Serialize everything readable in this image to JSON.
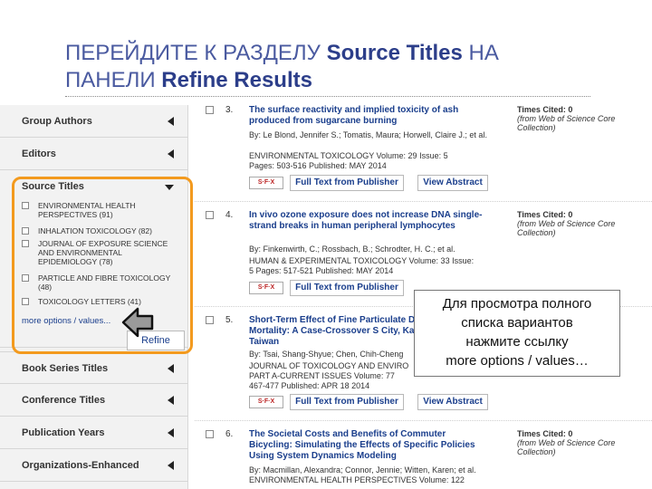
{
  "slide": {
    "title_line1_a": "ПЕРЕЙДИТЕ К РАЗДЕЛУ ",
    "title_line1_b": "Source Titles",
    "title_line1_c": "  НА",
    "title_line2_a": "ПАНЕЛИ ",
    "title_line2_b": "Refine Results"
  },
  "sidebar": {
    "group_authors": "Group Authors",
    "editors": "Editors",
    "source_titles": "Source Titles",
    "source_items": [
      "ENVIRONMENTAL HEALTH PERSPECTIVES (91)",
      "INHALATION TOXICOLOGY (82)",
      "JOURNAL OF EXPOSURE SCIENCE AND ENVIRONMENTAL EPIDEMIOLOGY (78)",
      "PARTICLE AND FIBRE TOXICOLOGY (48)",
      "TOXICOLOGY LETTERS (41)"
    ],
    "more_options": "more options / values...",
    "refine": "Refine",
    "book_series": "Book Series Titles",
    "conference": "Conference Titles",
    "publication_years": "Publication Years",
    "organizations": "Organizations-Enhanced"
  },
  "results": [
    {
      "num": "3.",
      "title": "The surface reactivity and implied toxicity of ash produced from sugarcane burning",
      "authors": "By: Le Blond, Jennifer S.; Tomatis, Maura; Horwell, Claire J.; et al.",
      "journal": "ENVIRONMENTAL TOXICOLOGY  Volume: 29  Issue: 5",
      "pages": "Pages: 503-516  Published: MAY 2014",
      "times_cited": "Times Cited: 0",
      "wos": "(from Web of Science Core Collection)"
    },
    {
      "num": "4.",
      "title": "In vivo ozone exposure does not increase DNA single-strand breaks in human peripheral lymphocytes",
      "authors": "By: Finkenwirth, C.; Rossbach, B.; Schrodter, H. C.; et al.",
      "journal": "HUMAN & EXPERIMENTAL TOXICOLOGY  Volume: 33  Issue:",
      "pages": "5  Pages: 517-521  Published: MAY 2014",
      "times_cited": "Times Cited: 0",
      "wos": "(from Web of Science Core Collection)"
    },
    {
      "num": "5.",
      "title": "Short-Term Effect of Fine Particulate Daily Mortality: A Case-Crossover S City, Kaohsiung, Taiwan",
      "authors": "By: Tsai, Shang-Shyue; Chen, Chih-Cheng",
      "journal": "JOURNAL OF TOXICOLOGY AND ENVIRO",
      "pages": "PART A-CURRENT ISSUES  Volume: 77",
      "pages2": "467-477  Published: APR 18 2014"
    },
    {
      "num": "6.",
      "title": "The Societal Costs and Benefits of Commuter Bicycling: Simulating the Effects of Specific Policies Using System Dynamics Modeling",
      "authors": "By: Macmillan, Alexandra; Connor, Jennie; Witten, Karen; et al.",
      "journal": "ENVIRONMENTAL HEALTH PERSPECTIVES  Volume: 122",
      "times_cited": "Times Cited: 0",
      "wos": "(from Web of Science Core Collection)"
    }
  ],
  "buttons": {
    "sfx": "S·F·X",
    "full_text": "Full Text from Publisher",
    "view_abstract": "View Abstract"
  },
  "callout": {
    "line1": "Для просмотра полного",
    "line2": "списка вариантов",
    "line3": "нажмите ссылку",
    "line4": "more options / values…"
  }
}
